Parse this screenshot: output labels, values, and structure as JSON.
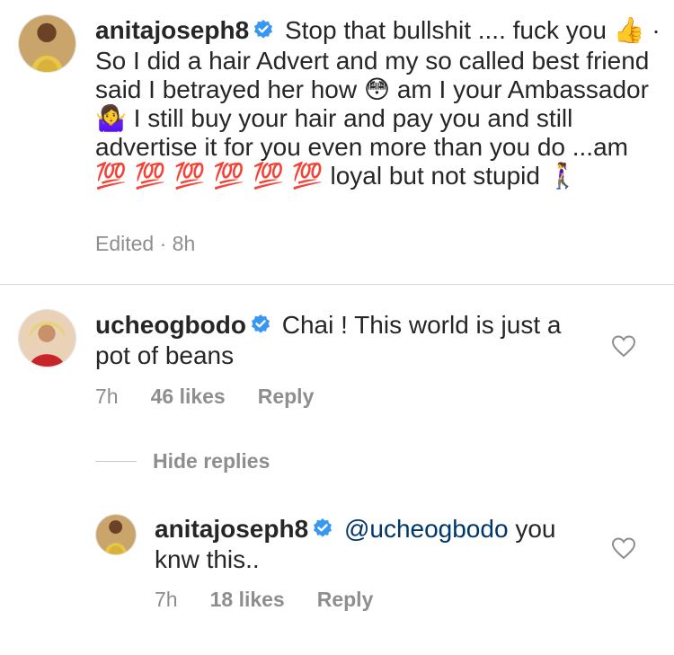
{
  "main_comment": {
    "username": "anitajoseph8",
    "text_part1": "Stop that bullshit .... fuck you",
    "emoji_thumbs": "👍",
    "text_part2": "· So I did a hair Advert and my so called best friend said I betrayed her how",
    "emoji_flushed": "😳",
    "text_part3": "am I your Ambassador",
    "emoji_shrug": "🤷‍♀️",
    "text_part4": "I still buy your hair and pay you and still advertise it for you even more than you do ...am",
    "emoji_hundred": "💯 💯 💯 💯 💯 💯",
    "text_part5": "loyal but not stupid",
    "emoji_walk": "🚶‍♀️",
    "meta_edited": "Edited · 8h"
  },
  "uche_comment": {
    "username": "ucheogbodo",
    "text": "Chai ! This world is just a pot of beans",
    "time": "7h",
    "likes": "46 likes",
    "reply": "Reply"
  },
  "hide_replies": "Hide replies",
  "reply_comment": {
    "username": "anitajoseph8",
    "mention": "@ucheogbodo",
    "text": "you knw this..",
    "time": "7h",
    "likes": "18 likes",
    "reply": "Reply"
  },
  "icons": {
    "verified": "verified-badge-icon",
    "heart": "heart-outline-icon"
  },
  "colors": {
    "verified_blue": "#3897f0",
    "meta_gray": "#8e8e8e",
    "mention_blue": "#00376b"
  }
}
